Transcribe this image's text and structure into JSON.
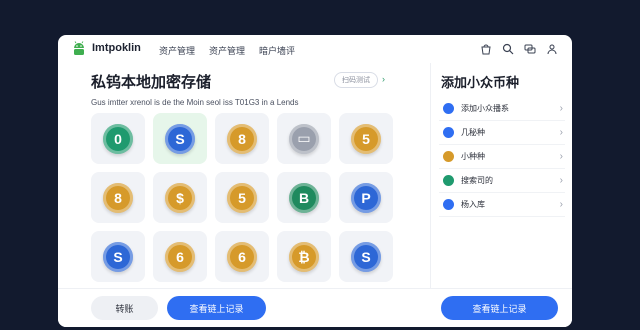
{
  "app": {
    "name": "Imtpoklin",
    "nav": [
      "资产管理",
      "资产管理",
      "暗户墙评"
    ],
    "top_icons": [
      "bag-icon",
      "search-icon",
      "chat-icon",
      "user-icon"
    ]
  },
  "main": {
    "title": "私钨本地加密存储",
    "subtitle": "Gus imtter xrenol is de the Moin seol iss T01G3 in a Lends",
    "filter_pill": "扫码测试",
    "coins": [
      {
        "symbol": "0",
        "color": "#1f9a6e",
        "selected": false
      },
      {
        "symbol": "S",
        "color": "#2d67d6",
        "selected": true
      },
      {
        "symbol": "8",
        "color": "#d69a2a",
        "selected": false
      },
      {
        "symbol": "▭",
        "color": "#9aa0ad",
        "selected": false
      },
      {
        "symbol": "5",
        "color": "#d69a2a",
        "selected": false
      },
      {
        "symbol": "8",
        "color": "#d69a2a",
        "selected": false
      },
      {
        "symbol": "$",
        "color": "#d69a2a",
        "selected": false
      },
      {
        "symbol": "5",
        "color": "#d69a2a",
        "selected": false
      },
      {
        "symbol": "B",
        "color": "#1f8a5e",
        "selected": false
      },
      {
        "symbol": "P",
        "color": "#2d67d6",
        "selected": false
      },
      {
        "symbol": "S",
        "color": "#2d67d6",
        "selected": false
      },
      {
        "symbol": "6",
        "color": "#d69a2a",
        "selected": false
      },
      {
        "symbol": "6",
        "color": "#d69a2a",
        "selected": false
      },
      {
        "symbol": "₿",
        "color": "#d69a2a",
        "selected": false
      },
      {
        "symbol": "S",
        "color": "#2d67d6",
        "selected": false
      }
    ]
  },
  "panel": {
    "title": "添加小众币种",
    "items": [
      {
        "label": "添加小众播系",
        "icon": "wallet-icon",
        "color": "#2f6ef2"
      },
      {
        "label": "几秘种",
        "icon": "filter-icon",
        "color": "#2f6ef2"
      },
      {
        "label": "小种种",
        "icon": "coin-icon",
        "color": "#d69a2a"
      },
      {
        "label": "搜索司的",
        "icon": "target-icon",
        "color": "#1f9a6e"
      },
      {
        "label": "杨入库",
        "icon": "import-icon",
        "color": "#2f6ef2"
      }
    ]
  },
  "footer": {
    "transfer_label": "转账",
    "chain_record_label": "查看链上记录",
    "panel_button_label": "查看链上记录"
  },
  "colors": {
    "accent": "#2f6ef2",
    "background": "#121a2e"
  }
}
